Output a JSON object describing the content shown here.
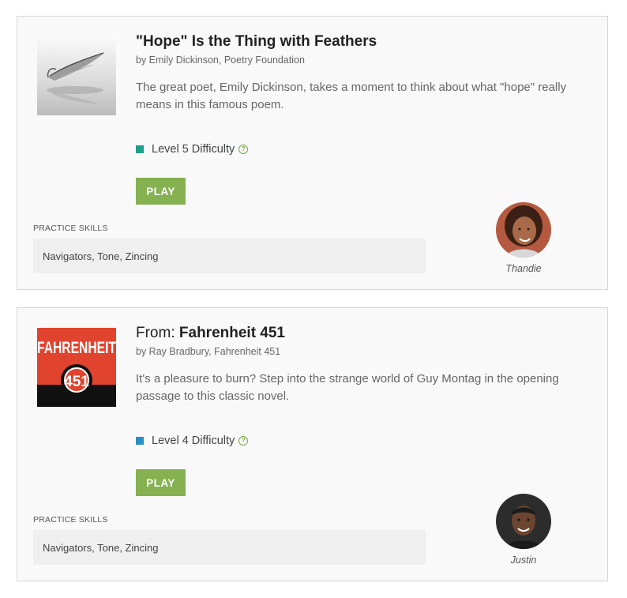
{
  "cards": [
    {
      "title": "\"Hope\" Is the Thing with Feathers",
      "byline": "by Emily Dickinson, Poetry Foundation",
      "description": "The great poet, Emily Dickinson, takes a moment to think about what \"hope\" really means in this famous poem.",
      "level": "Level 5 Difficulty",
      "level_color": "#1fa08a",
      "play_label": "PLAY",
      "skills_label": "PRACTICE SKILLS",
      "skills": "Navigators, Tone, Zincing",
      "coach": "Thandie"
    },
    {
      "title_prefix": "From: ",
      "title": "Fahrenheit 451",
      "byline": "by Ray Bradbury, Fahrenheit 451",
      "description": "It's a pleasure to burn? Step into the strange world of Guy Montag in the opening passage to this classic novel.",
      "level": "Level 4 Difficulty",
      "level_color": "#2a8fc4",
      "play_label": "PLAY",
      "skills_label": "PRACTICE SKILLS",
      "skills": "Navigators, Tone, Zincing",
      "coach": "Justin",
      "cover_text_top": "FAHRENHEIT",
      "cover_text_num": "451"
    }
  ],
  "icons": {
    "help": "?"
  }
}
